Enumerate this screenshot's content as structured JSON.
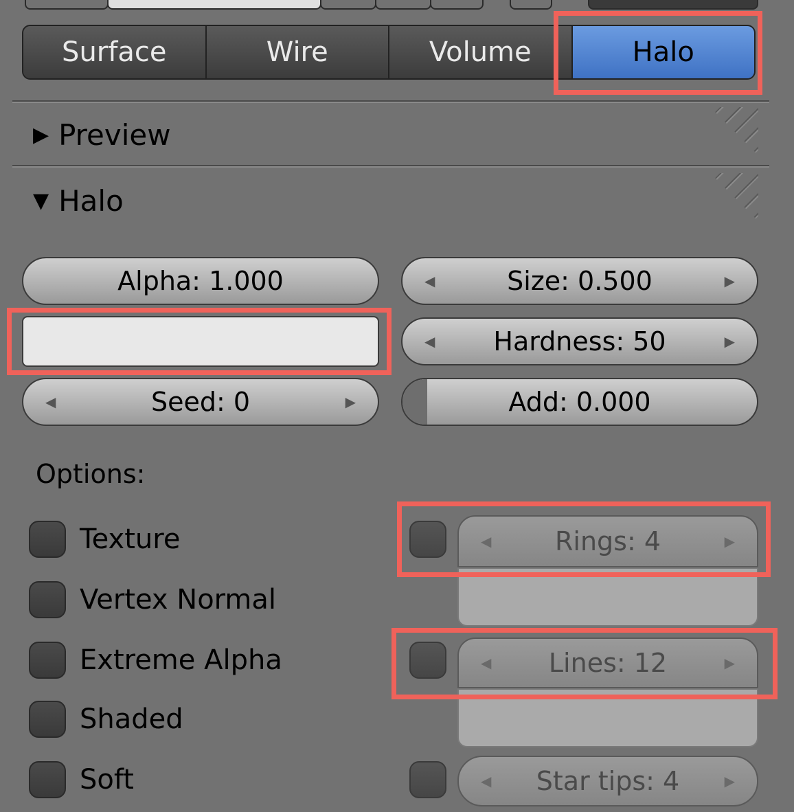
{
  "tabs": [
    {
      "label": "Surface",
      "active": false
    },
    {
      "label": "Wire",
      "active": false
    },
    {
      "label": "Volume",
      "active": false
    },
    {
      "label": "Halo",
      "active": true
    }
  ],
  "panels": {
    "preview": {
      "title": "Preview",
      "collapsed": true
    },
    "halo": {
      "title": "Halo",
      "collapsed": false
    }
  },
  "fields": {
    "alpha": "Alpha: 1.000",
    "size": "Size: 0.500",
    "hardness": "Hardness: 50",
    "seed": "Seed: 0",
    "add": "Add: 0.000",
    "rings": "Rings: 4",
    "lines": "Lines: 12",
    "star_tips": "Star tips: 4"
  },
  "options_label": "Options:",
  "options": [
    {
      "label": "Texture",
      "checked": false
    },
    {
      "label": "Vertex Normal",
      "checked": false
    },
    {
      "label": "Extreme Alpha",
      "checked": false
    },
    {
      "label": "Shaded",
      "checked": false
    },
    {
      "label": "Soft",
      "checked": false
    }
  ],
  "colors": {
    "accent": "#4f84d6",
    "highlight": "#f0625a",
    "background": "#727272",
    "halo_color": "#e8e8e8"
  },
  "icons": {
    "collapsed": "triangle-right-icon",
    "expanded": "triangle-down-icon"
  }
}
